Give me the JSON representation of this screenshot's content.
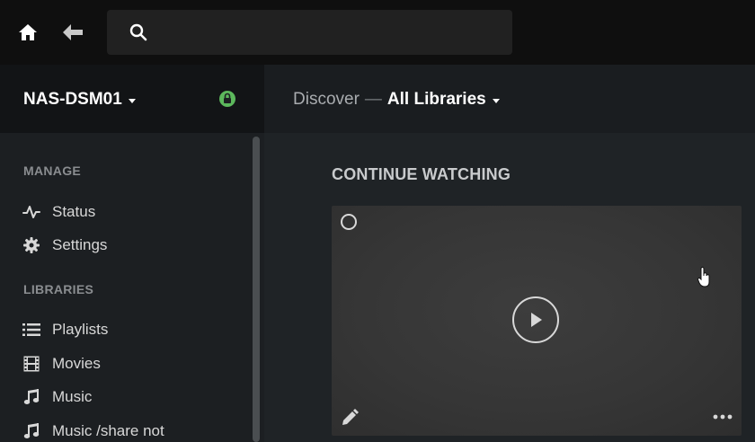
{
  "search": {
    "value": "",
    "placeholder": ""
  },
  "server": {
    "name": "NAS-DSM01"
  },
  "header": {
    "discover": "Discover",
    "separator": "—",
    "library": "All Libraries"
  },
  "sidebar": {
    "manage_title": "MANAGE",
    "manage_items": [
      {
        "label": "Status",
        "icon": "activity-icon"
      },
      {
        "label": "Settings",
        "icon": "gear-icon"
      }
    ],
    "libraries_title": "LIBRARIES",
    "library_items": [
      {
        "label": "Playlists",
        "icon": "list-icon"
      },
      {
        "label": "Movies",
        "icon": "film-icon"
      },
      {
        "label": "Music",
        "icon": "music-note-icon"
      },
      {
        "label": "Music /share not",
        "icon": "music-note-icon"
      }
    ]
  },
  "main": {
    "continue_watching": "CONTINUE WATCHING"
  },
  "colors": {
    "accent_green": "#5cb85c",
    "background": "#1f2326",
    "topbar": "#0f0f0f"
  }
}
